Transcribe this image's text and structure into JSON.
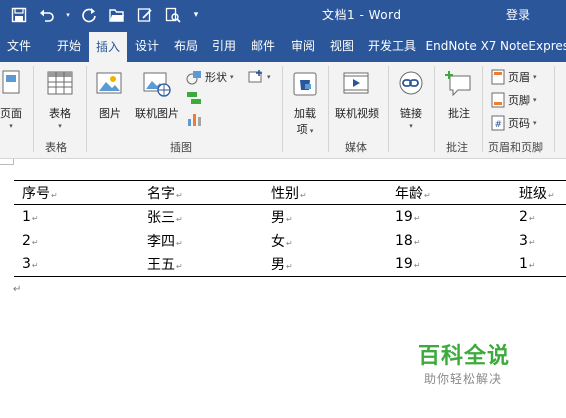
{
  "titlebar": {
    "doc_title": "文档1 - Word",
    "login": "登录",
    "qat_icons": [
      "save-icon",
      "undo-icon",
      "redo-icon",
      "open-icon",
      "edit-icon",
      "print-preview-icon",
      "customize-icon"
    ]
  },
  "tabs": [
    "文件",
    "开始",
    "插入",
    "设计",
    "布局",
    "引用",
    "邮件",
    "审阅",
    "视图",
    "开发工具",
    "EndNote X7",
    "NoteExpress"
  ],
  "active_tab": "插入",
  "ribbon": {
    "pages": {
      "button": "页面",
      "group": ""
    },
    "tables": {
      "button": "表格",
      "group": "表格"
    },
    "illustrations": {
      "picture": "图片",
      "online_picture": "联机图片",
      "shapes": "形状",
      "group": "插图"
    },
    "addins": {
      "button_line1": "加载",
      "button_line2": "项"
    },
    "media": {
      "button": "联机视频",
      "group": "媒体"
    },
    "links": {
      "button": "链接"
    },
    "comments": {
      "button": "批注",
      "group": "批注"
    },
    "header_footer": {
      "header": "页眉",
      "footer": "页脚",
      "page_number": "页码",
      "group": "页眉和页脚"
    }
  },
  "colors": {
    "brand": "#2b579a",
    "ribbon_bg": "#f3f3f3",
    "watermark": "#3cab3c"
  },
  "table": {
    "headers": [
      "序号",
      "名字",
      "性别",
      "年龄",
      "班级"
    ],
    "rows": [
      [
        "1",
        "张三",
        "男",
        "19",
        "2"
      ],
      [
        "2",
        "李四",
        "女",
        "18",
        "3"
      ],
      [
        "3",
        "王五",
        "男",
        "19",
        "1"
      ]
    ]
  },
  "watermark": {
    "main": "百科全说",
    "sub": "助你轻松解决"
  }
}
